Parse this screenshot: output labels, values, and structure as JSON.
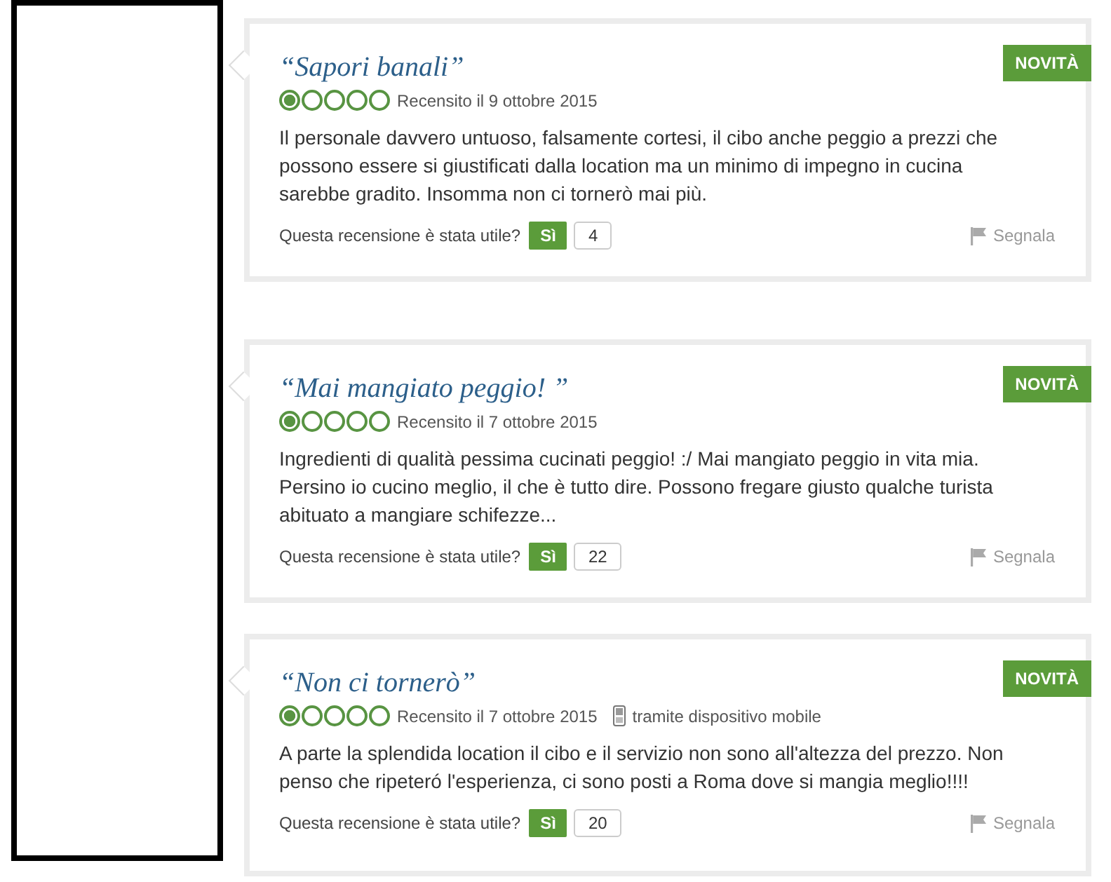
{
  "reviews": [
    {
      "title": "“Sapori banali”",
      "badge": "NOVITÀ",
      "stars": 1,
      "date": "Recensito il 9 ottobre 2015",
      "text": "Il personale davvero untuoso, falsamente cortesi, il cibo anche peggio a prezzi che possono essere si giustificati dalla location ma un minimo di impegno in cucina sarebbe gradito. Insomma non ci tornerò mai più.",
      "helpful_prompt": "Questa recensione è stata utile?",
      "yes_button": "Sì",
      "count": "4",
      "report": "Segnala"
    },
    {
      "title": "“Mai mangiato peggio! ”",
      "badge": "NOVITÀ",
      "stars": 1,
      "date": "Recensito il 7 ottobre 2015",
      "text": "Ingredienti di qualità pessima cucinati peggio! :/ Mai mangiato peggio in vita mia. Persino io cucino meglio, il che è tutto dire. Possono fregare giusto qualche turista abituato a mangiare schifezze...",
      "helpful_prompt": "Questa recensione è stata utile?",
      "yes_button": "Sì",
      "count": "22",
      "report": "Segnala"
    },
    {
      "title": "“Non ci tornerò”",
      "badge": "NOVITÀ",
      "stars": 1,
      "date": "Recensito il 7 ottobre 2015",
      "via": "tramite dispositivo mobile",
      "text": "A parte la splendida location il cibo e il servizio non sono all'altezza del prezzo. Non penso che ripeteró l'esperienza, ci sono posti a Roma dove si mangia meglio!!!!",
      "helpful_prompt": "Questa recensione è stata utile?",
      "yes_button": "Sì",
      "count": "20",
      "report": "Segnala"
    }
  ]
}
